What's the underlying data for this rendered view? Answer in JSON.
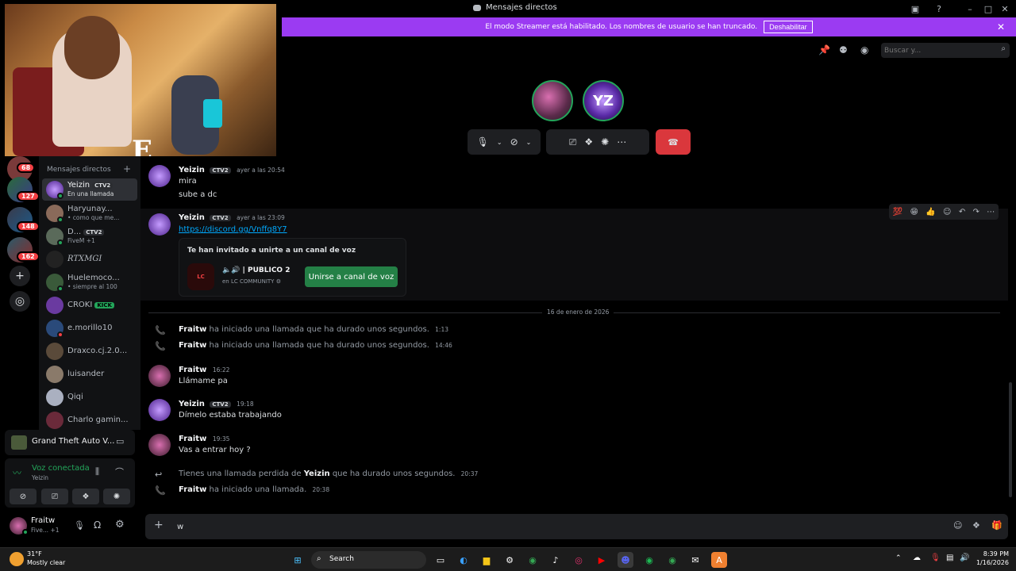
{
  "window": {
    "title": "Mensajes directos"
  },
  "banner": {
    "text": "El modo Streamer está habilitado. Los nombres de usuario se han truncado.",
    "button_label": "Deshabilitar",
    "color": "#9b3bf2"
  },
  "topbar": {
    "search_placeholder": "Buscar y..."
  },
  "rail": {
    "badges": [
      "68",
      "127",
      "148",
      "162"
    ]
  },
  "sidebar": {
    "header": "Mensajes directos",
    "items": [
      {
        "name": "Yeizin",
        "tag": "CTV2",
        "sub": "En una llamada"
      },
      {
        "name": "Haryunay...",
        "tag": "",
        "sub": "• como que me..."
      },
      {
        "name": "D...",
        "tag": "CTV2",
        "sub": "FiveM +1"
      },
      {
        "name": "RTXMGI",
        "tag": "",
        "sub": ""
      },
      {
        "name": "Huelemoco...",
        "tag": "",
        "sub": "• siempre al 100"
      },
      {
        "name": "CROKI",
        "tag": "KICK",
        "sub": ""
      },
      {
        "name": "e.morillo10",
        "tag": "",
        "sub": ""
      },
      {
        "name": "Draxco.cj.2.0...",
        "tag": "",
        "sub": ""
      },
      {
        "name": "luisander",
        "tag": "",
        "sub": ""
      },
      {
        "name": "Qiqi",
        "tag": "",
        "sub": ""
      },
      {
        "name": "Charlo gamin...",
        "tag": "",
        "sub": ""
      }
    ]
  },
  "game_panel": {
    "title": "Grand Theft Auto V..."
  },
  "voice_panel": {
    "status": "Voz conectada",
    "channel": "Yeizin",
    "status_color": "#23a55a"
  },
  "user_panel": {
    "name": "Fraitw",
    "sub": "Five... +1"
  },
  "chat": {
    "messages": [
      {
        "author": "Yeizin",
        "tag": "CTV2",
        "time": "ayer a las 20:54",
        "lines": [
          "mira",
          "sube a dc"
        ]
      },
      {
        "author": "Yeizin",
        "tag": "CTV2",
        "time": "ayer a las 23:09",
        "link": "https://discord.gg/Vnffq8Y7"
      }
    ],
    "invite": {
      "title": "Te han invitado a unirte a un canal de voz",
      "channel": "PUBLICO 2",
      "server_prefix": "en",
      "server": "LC COMMUNITY",
      "icon_text": "LC",
      "join_label": "Unirse a canal de voz",
      "join_color": "#248046"
    },
    "date_divider": "16 de enero de 2026",
    "events": [
      {
        "author": "Fraitw",
        "text": "ha iniciado una llamada que ha durado unos segundos.",
        "time": "1:13"
      },
      {
        "author": "Fraitw",
        "text": "ha iniciado una llamada que ha durado unos segundos.",
        "time": "14:46"
      }
    ],
    "messages2": [
      {
        "author": "Fraitw",
        "time": "16:22",
        "text": "Llámame pa"
      },
      {
        "author": "Yeizin",
        "tag": "CTV2",
        "time": "19:18",
        "text": "Dímelo estaba trabajando"
      },
      {
        "author": "Fraitw",
        "time": "19:35",
        "text": "Vas a entrar hoy ?"
      }
    ],
    "missed": {
      "pre": "Tienes una llamada perdida de",
      "author": "Yeizin",
      "post": "que ha durado unos segundos.",
      "time": "20:37"
    },
    "last_event": {
      "author": "Fraitw",
      "text": "ha iniciado una llamada.",
      "time": "20:38"
    },
    "input_value": "w"
  },
  "taskbar": {
    "weather_temp": "31°F",
    "weather_desc": "Mostly clear",
    "search_label": "Search",
    "time": "8:39 PM",
    "date": "1/16/2026"
  }
}
